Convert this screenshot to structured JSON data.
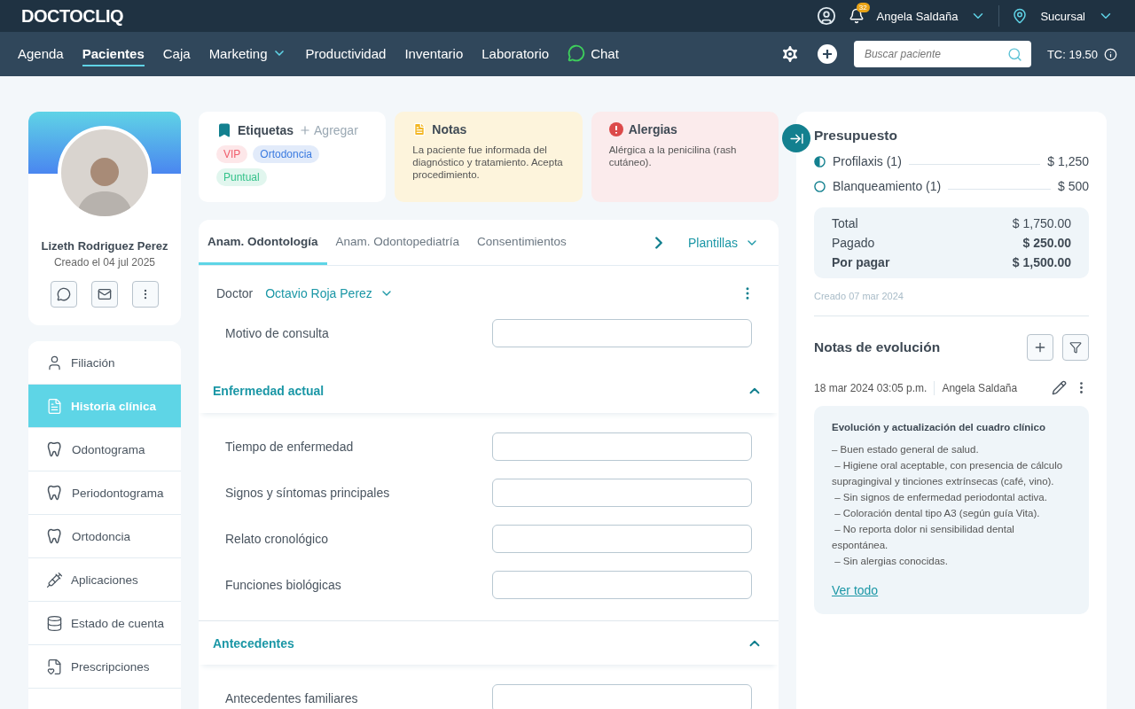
{
  "brand": {
    "logo": "DOCTOCLIQ"
  },
  "topbar": {
    "notifications": "32",
    "user": "Angela Saldaña",
    "branch": "Sucursal"
  },
  "nav": {
    "items": [
      {
        "label": "Agenda",
        "selected": false,
        "dropdown": false,
        "kind": "text"
      },
      {
        "label": "Pacientes",
        "selected": true,
        "dropdown": false,
        "kind": "text"
      },
      {
        "label": "Caja",
        "selected": false,
        "dropdown": false,
        "kind": "text"
      },
      {
        "label": "Marketing",
        "selected": false,
        "dropdown": true,
        "kind": "text"
      },
      {
        "label": "Productividad",
        "selected": false,
        "dropdown": false,
        "kind": "text"
      },
      {
        "label": "Inventario",
        "selected": false,
        "dropdown": false,
        "kind": "text"
      },
      {
        "label": "Laboratorio",
        "selected": false,
        "dropdown": false,
        "kind": "text"
      },
      {
        "label": "Chat",
        "selected": false,
        "dropdown": false,
        "kind": "chat"
      }
    ],
    "search": {
      "placeholder": "Buscar paciente"
    },
    "exchange": "TC: 19.50"
  },
  "patient": {
    "name": "Lizeth Rodriguez Perez",
    "created": "Creado el 04 jul 2025"
  },
  "menu": [
    {
      "label": "Filiación",
      "kind": "profile",
      "selected": false
    },
    {
      "label": "Historia clínica",
      "kind": "record",
      "selected": true
    },
    {
      "label": "Odontograma",
      "kind": "chart",
      "selected": false
    },
    {
      "label": "Periodontograma",
      "kind": "chart",
      "selected": false
    },
    {
      "label": "Ortodoncia",
      "kind": "chart",
      "selected": false
    },
    {
      "label": "Aplicaciones",
      "kind": "treatment",
      "selected": false
    },
    {
      "label": "Estado de cuenta",
      "kind": "account",
      "selected": false
    },
    {
      "label": "Prescripciones",
      "kind": "prescription",
      "selected": false
    }
  ],
  "tags": {
    "title": "Etiquetas",
    "add": "Agregar",
    "items": [
      {
        "label": "VIP",
        "color": "#f05d6c"
      },
      {
        "label": "Ortodoncia",
        "color": "#3b7be0"
      },
      {
        "label": "Puntual",
        "color": "#34c28a"
      }
    ]
  },
  "notes": {
    "title": "Notas",
    "text": "La paciente fue informada del diagnóstico y tratamiento. Acepta procedimiento."
  },
  "allergies": {
    "title": "Alergias",
    "text": "Alérgica a la penicilina (rash cutáneo)."
  },
  "history": {
    "tabs": [
      {
        "label": "Anam. Odontología",
        "selected": true
      },
      {
        "label": "Anam. Odontopediatría",
        "selected": false
      },
      {
        "label": "Consentimientos",
        "selected": false
      }
    ],
    "templates": "Plantillas",
    "doctor_label": "Doctor",
    "doctor": "Octavio Roja Perez",
    "fields": [
      "Motivo de consulta"
    ],
    "sections": [
      {
        "title": "Enfermedad actual",
        "expanded": true,
        "fields": [
          "Tiempo de enfermedad",
          "Signos y síntomas principales",
          "Relato cronológico",
          "Funciones biológicas"
        ]
      },
      {
        "title": "Antecedentes",
        "expanded": true,
        "fields": [
          "Antecedentes familiares"
        ]
      }
    ]
  },
  "budget": {
    "title": "Presupuesto",
    "items": [
      {
        "label": "Profilaxis (1)",
        "amount": "$ 1,250",
        "kind": "partial"
      },
      {
        "label": "Blanqueamiento (1)",
        "amount": "$ 500",
        "kind": "pending"
      }
    ],
    "totals": [
      {
        "label": "Total",
        "value": "$ 1,750.00",
        "kind": "plain"
      },
      {
        "label": "Pagado",
        "value": "$ 250.00",
        "kind": "paid"
      },
      {
        "label": "Por pagar",
        "value": "$ 1,500.00",
        "kind": "due"
      }
    ],
    "created": "Creado 07 mar 2024"
  },
  "evolution": {
    "title": "Notas de evolución",
    "date": "18 mar 2024 03:05 p.m.",
    "author": "Angela Saldaña",
    "note_title": "Evolución y actualización del cuadro clínico",
    "lines": [
      "– Buen estado general de salud.",
      " – Higiene oral aceptable, con presencia de cálculo supragingival y tinciones extrínsecas (café, vino).",
      " – Sin signos de enfermedad periodontal activa.",
      " – Coloración dental tipo A3 (según guía Vita).",
      " – No reporta dolor ni sensibilidad dental espontánea.",
      " – Sin alergias conocidas."
    ],
    "link": "Ver todo"
  }
}
